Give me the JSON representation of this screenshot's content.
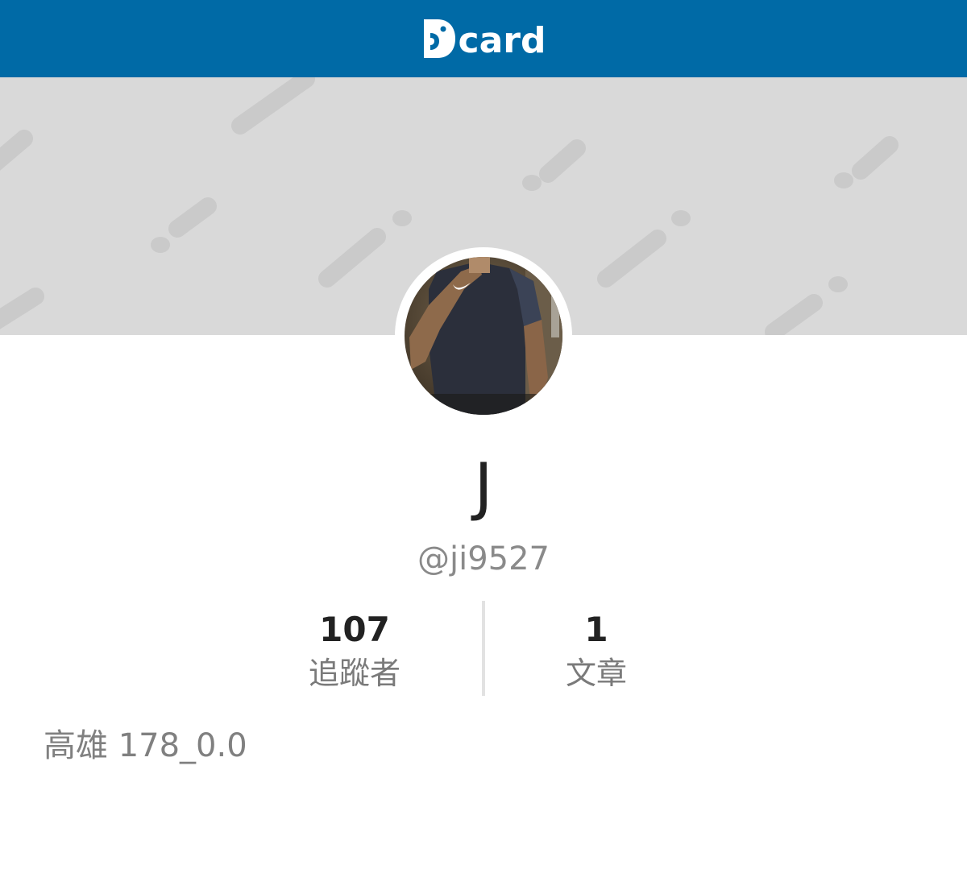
{
  "header": {
    "logo_text": "card",
    "brand_color": "#006aa6"
  },
  "cover": {
    "background_color": "#d9d9d9"
  },
  "profile": {
    "avatar_icon": "avatar-photo",
    "display_name": "J",
    "handle": "@ji9527",
    "bio": "高雄 178_0.0"
  },
  "stats": [
    {
      "value": "107",
      "label": "追蹤者"
    },
    {
      "value": "1",
      "label": "文章"
    }
  ],
  "colors": {
    "name_text": "#222222",
    "handle_text": "#8a8a8a",
    "label_text": "#7a7a7a",
    "divider": "#e2e2e2"
  }
}
